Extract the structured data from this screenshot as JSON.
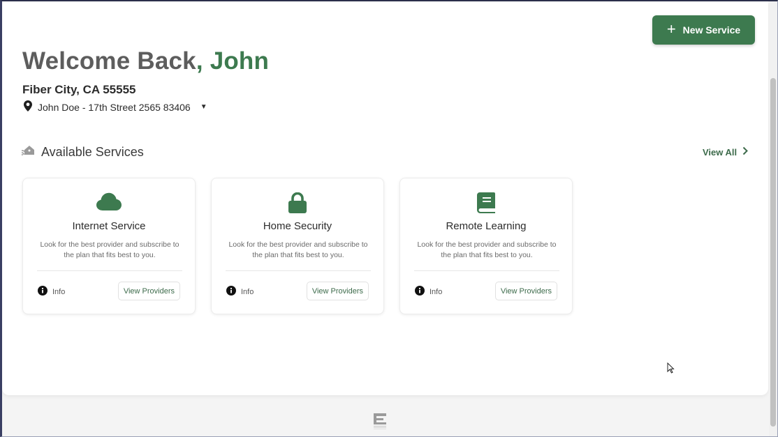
{
  "colors": {
    "brand_green": "#3d7a4f",
    "link_green": "#3d6b4b",
    "heading_gray": "#5d5d5d"
  },
  "header": {
    "welcome_prefix": "Welcome Back",
    "welcome_comma": ", ",
    "user_name": "John",
    "new_service_label": "New Service",
    "new_service_icon": "plus-icon"
  },
  "location": {
    "city": "Fiber City, CA 55555",
    "address": "John Doe - 17th Street 2565 83406",
    "pin_icon": "map-pin-icon",
    "dropdown_icon": "caret-down-icon"
  },
  "services_section": {
    "title": "Available Services",
    "icon": "smart-home-icon",
    "view_all_label": "View All"
  },
  "services": [
    {
      "title": "Internet Service",
      "icon": "cloud-icon",
      "description": "Look for the best provider and subscribe to the plan that fits best to you.",
      "info_label": "Info",
      "button_label": "View Providers"
    },
    {
      "title": "Home Security",
      "icon": "lock-icon",
      "description": "Look for the best provider and subscribe to the plan that fits best to you.",
      "info_label": "Info",
      "button_label": "View Providers"
    },
    {
      "title": "Remote Learning",
      "icon": "book-icon",
      "description": "Look for the best provider and subscribe to the plan that fits best to you.",
      "info_label": "Info",
      "button_label": "View Providers"
    }
  ]
}
